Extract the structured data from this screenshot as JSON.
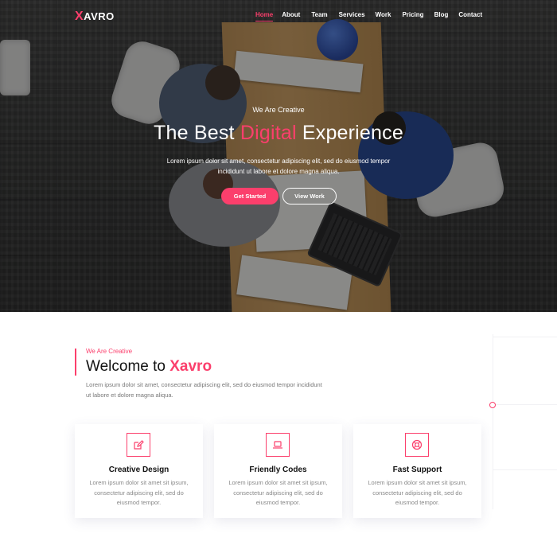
{
  "brand": {
    "logo_x": "X",
    "logo_rest": "AVRO"
  },
  "nav": {
    "items": [
      "Home",
      "About",
      "Team",
      "Services",
      "Work",
      "Pricing",
      "Blog",
      "Contact"
    ],
    "active": "Home"
  },
  "hero": {
    "kicker": "We Are Creative",
    "title_before": "The Best ",
    "title_highlight": "Digital",
    "title_after": " Experience",
    "description": "Lorem ipsum dolor sit amet, consectetur adipiscing elit, sed do eiusmod tempor incididunt ut labore et dolore magna aliqua.",
    "primary_button": "Get Started",
    "secondary_button": "View Work"
  },
  "welcome": {
    "kicker": "We Are Creative",
    "title_prefix": "Welcome to ",
    "title_brand": "Xavro",
    "description": "Lorem ipsum dolor sit amet, consectetur adipiscing elit, sed do eiusmod tempor incididunt ut labore et dolore magna aliqua."
  },
  "features": [
    {
      "icon": "edit-icon",
      "title": "Creative Design",
      "description": "Lorem ipsum dolor sit amet sit ipsum, consectetur adipiscing elit, sed do eiusmod tempor."
    },
    {
      "icon": "laptop-icon",
      "title": "Friendly Codes",
      "description": "Lorem ipsum dolor sit amet sit ipsum, consectetur adipiscing elit, sed do eiusmod tempor."
    },
    {
      "icon": "lifebuoy-icon",
      "title": "Fast Support",
      "description": "Lorem ipsum dolor sit amet sit ipsum, consectetur adipiscing elit, sed do eiusmod tempor."
    }
  ],
  "colors": {
    "accent": "#fb3f6c",
    "text_dark": "#111111",
    "text_muted": "#888888"
  }
}
